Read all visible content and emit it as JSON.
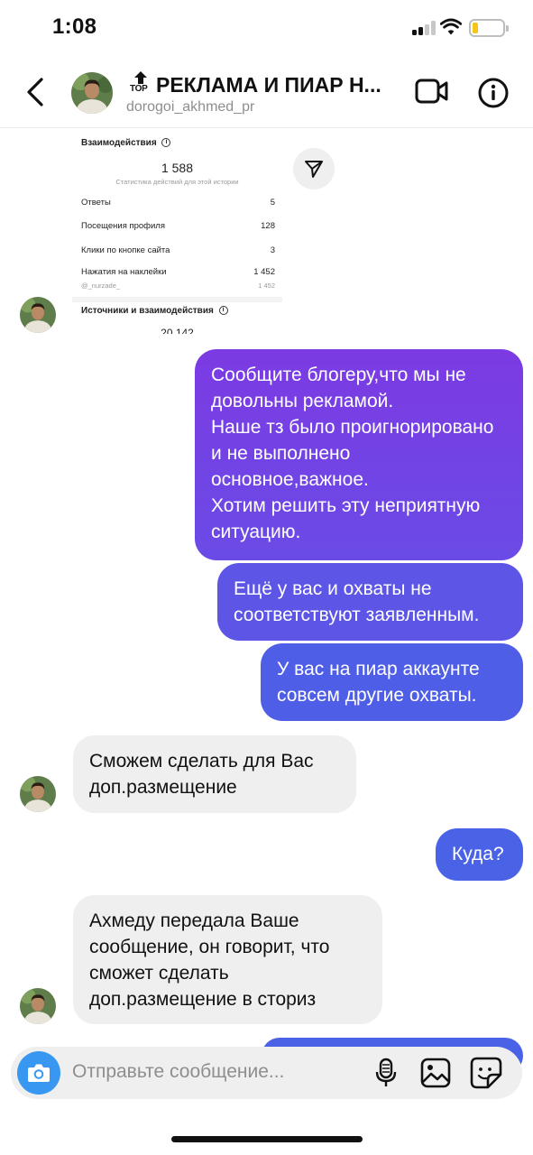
{
  "status_bar": {
    "time": "1:08",
    "battery_level": 0.2,
    "battery_color": "#f5c518"
  },
  "header": {
    "back_icon": "chevron-left-icon",
    "badge": "TOP",
    "title": "РЕКЛАМА И ПИАР Н...",
    "username": "dorogoi_akhmed_pr",
    "video_icon": "video-camera-icon",
    "info_icon": "info-icon"
  },
  "story_card": {
    "interactions_title": "Взаимодействия",
    "total": "1 588",
    "caption": "Статистика действий для этой истории",
    "rows": [
      {
        "label": "Ответы",
        "value": "5"
      },
      {
        "label": "Посещения профиля",
        "value": "128"
      },
      {
        "label": "Клики по кнопке сайта",
        "value": "3"
      },
      {
        "label": "Нажатия на наклейки",
        "value": "1 452"
      }
    ],
    "sticker_handle": "@_nurzade_",
    "sticker_value": "1 452",
    "sources_title": "Источники и взаимодействия",
    "cut_value": "20 142"
  },
  "messages": [
    {
      "side": "out",
      "text": "Сообщите блогеру,что мы не довольны рекламой.\nНаше тз было проигнорировано и не выполнено основное,важное.\nХотим решить эту неприятную ситуацию."
    },
    {
      "side": "out",
      "text": "Ещё у вас и охваты не соответствуют заявленным."
    },
    {
      "side": "out",
      "text": "У вас на пиар аккаунте совсем другие охваты."
    },
    {
      "side": "in",
      "text": "Сможем сделать для Вас доп.размещение"
    },
    {
      "side": "out",
      "text": "Куда?"
    },
    {
      "side": "in",
      "text": "Ахмеду передала Ваше сообщение, он говорит, что сможет сделать доп.размещение в сториз"
    }
  ],
  "composer": {
    "placeholder": "Отправьте сообщение...",
    "camera_icon": "camera-icon",
    "mic_icon": "microphone-icon",
    "gallery_icon": "gallery-icon",
    "sticker_icon": "sticker-icon"
  },
  "colors": {
    "accent_blue": "#3897f0",
    "gradient_top": "#7b3fe4",
    "gradient_bottom": "#4a63e6",
    "incoming_bubble": "#efefef"
  }
}
